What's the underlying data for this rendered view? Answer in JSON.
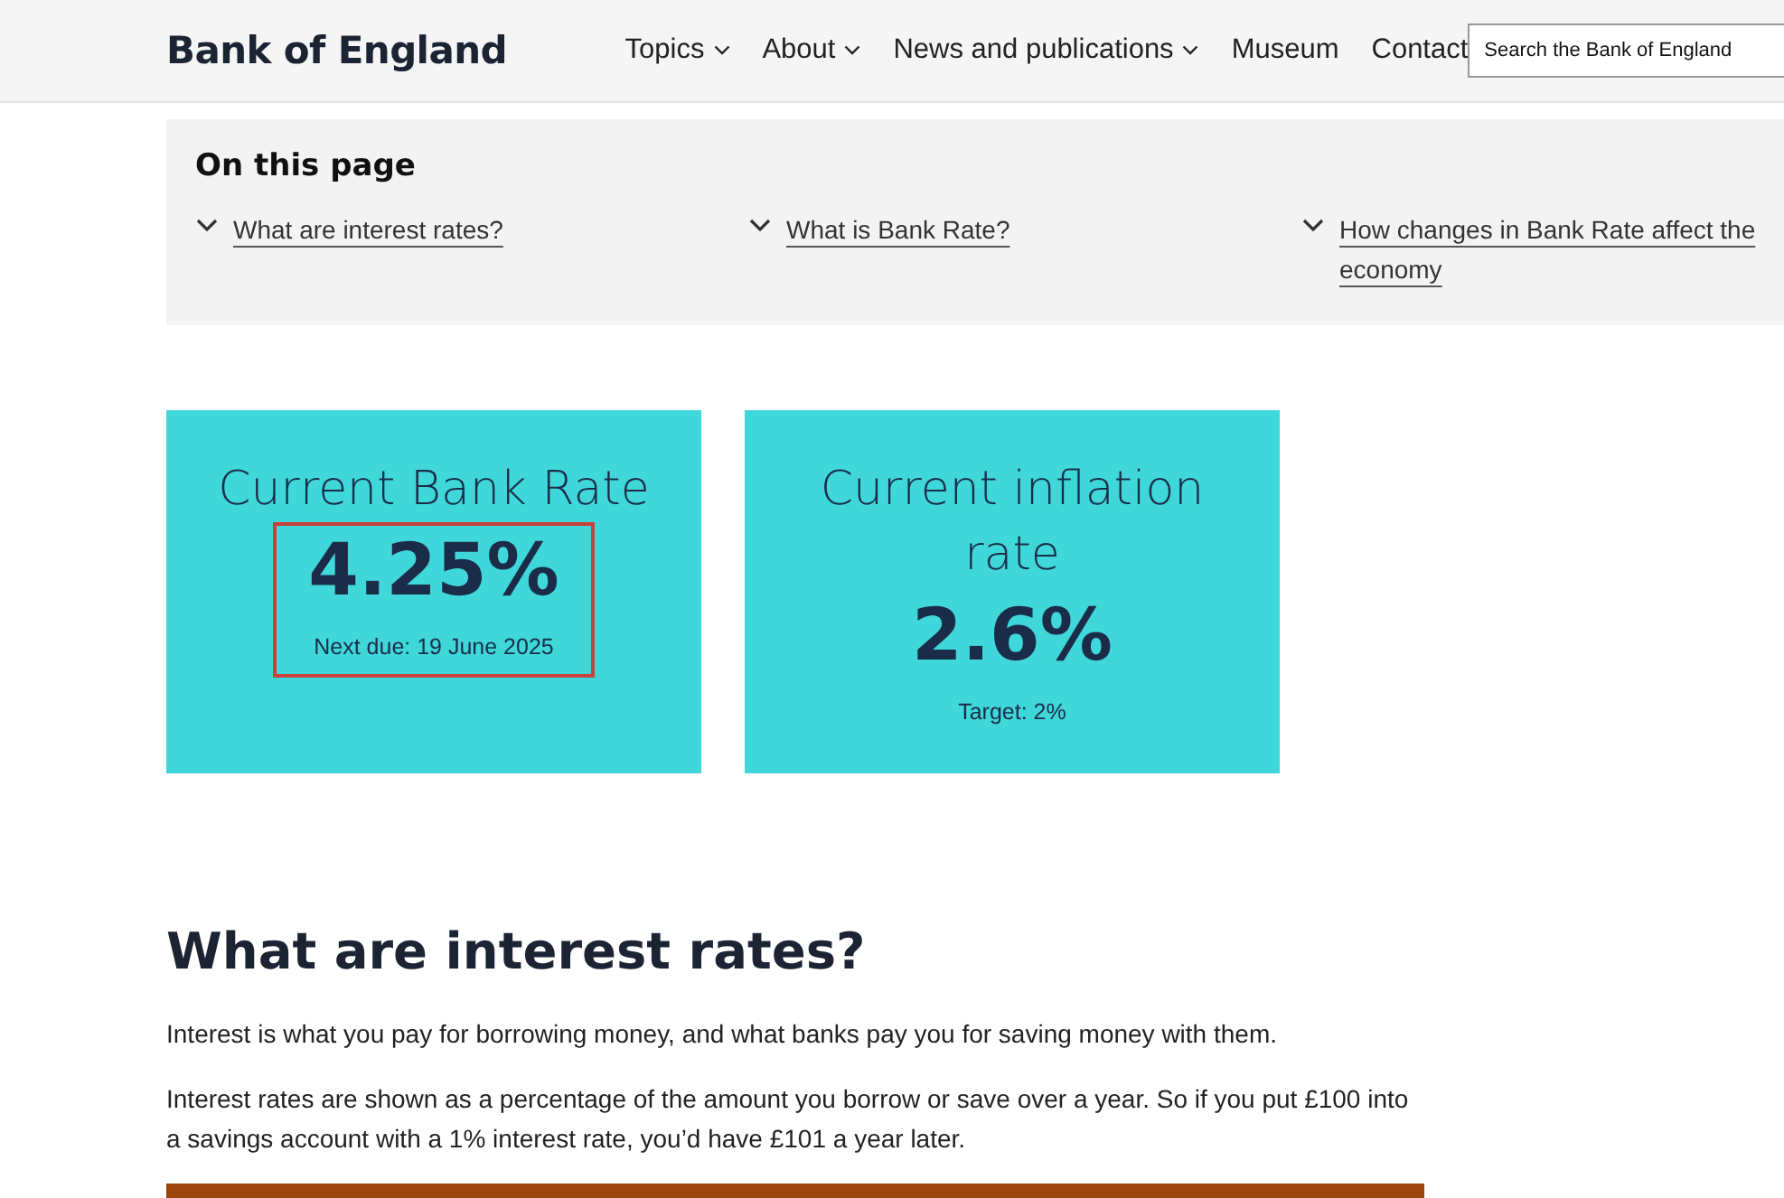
{
  "header": {
    "logo": "Bank of England",
    "nav": [
      {
        "label": "Topics",
        "dropdown": true
      },
      {
        "label": "About",
        "dropdown": true
      },
      {
        "label": "News and publications",
        "dropdown": true
      },
      {
        "label": "Museum",
        "dropdown": false
      },
      {
        "label": "Contact",
        "dropdown": false
      }
    ],
    "search": {
      "placeholder": "Search the Bank of England"
    }
  },
  "on_this_page": {
    "title": "On this page",
    "links": [
      "What are interest rates?",
      "What is Bank Rate?",
      "How changes in Bank Rate affect the economy"
    ]
  },
  "cards": [
    {
      "title": "Current Bank Rate",
      "value": "4.25%",
      "note": "Next due: 19 June 2025",
      "highlighted": true
    },
    {
      "title": "Current inflation rate",
      "value": "2.6%",
      "note": "Target: 2%",
      "highlighted": false
    }
  ],
  "section": {
    "heading": "What are interest rates?",
    "paragraphs": [
      "Interest is what you pay for borrowing money, and what banks pay you for saving money with them.",
      "Interest rates are shown as a percentage of the amount you borrow or save over a year. So if you put £100 into a savings account with a 1% interest rate, you’d have £101 a year later."
    ]
  }
}
